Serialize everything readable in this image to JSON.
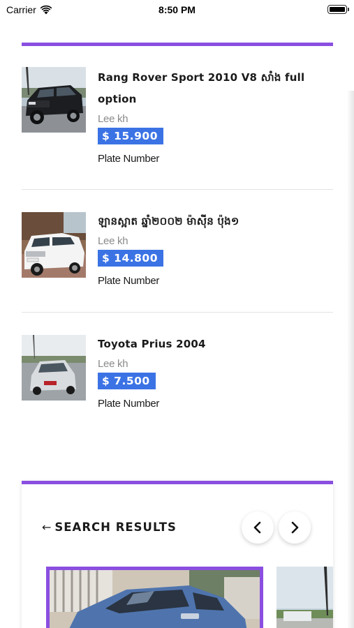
{
  "status_bar": {
    "carrier": "Carrier",
    "time": "8:50 PM"
  },
  "listings": [
    {
      "title": "Rang Rover Sport 2010 V8 សាំង full option",
      "seller": "Lee kh",
      "price": "$ 15.900",
      "plate": "Plate Number",
      "image": "black-suv-photo"
    },
    {
      "title": "ឡានស្អាត ឆ្នាំ២០០២ ម៉ាស៊ីន ប៉ុង១",
      "seller": "Lee kh",
      "price": "$ 14.800",
      "plate": "Plate Number",
      "image": "white-suv-photo"
    },
    {
      "title": "Toyota Prius 2004",
      "seller": "Lee kh",
      "price": "$ 7.500",
      "plate": "Plate Number",
      "image": "silver-sedan-photo"
    }
  ],
  "search_results": {
    "back_label": "SEARCH RESULTS",
    "prev_icon": "chevron-left-icon",
    "next_icon": "chevron-right-icon"
  },
  "colors": {
    "accent": "#8a4fe0",
    "price_bg": "#3b73e5",
    "seller_text": "#8a8a8a"
  }
}
